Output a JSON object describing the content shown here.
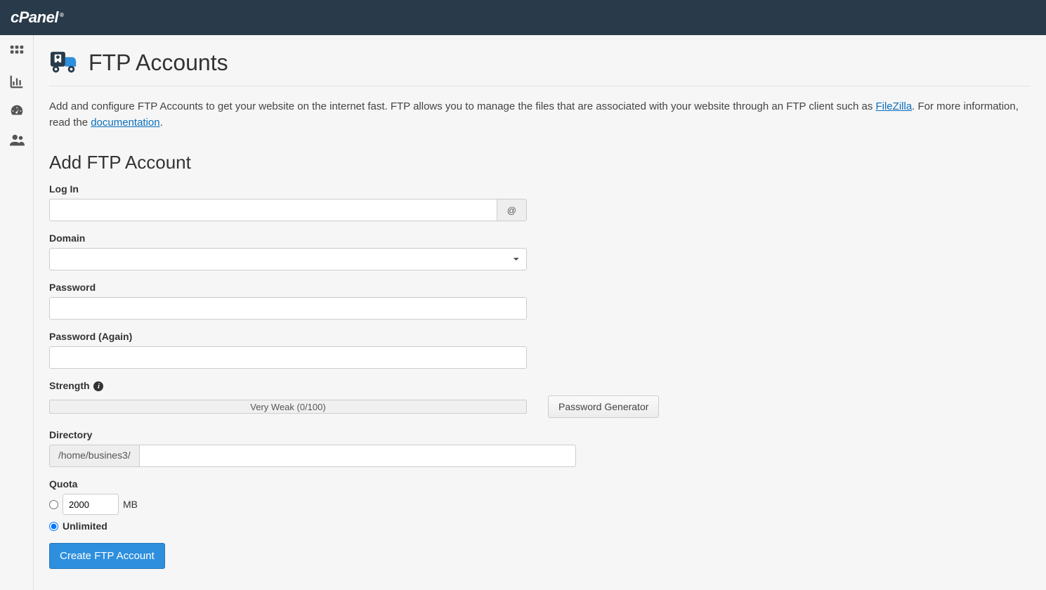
{
  "brand": "cPanel",
  "page": {
    "title": "FTP Accounts",
    "intro_pre": "Add and configure FTP Accounts to get your website on the internet fast. FTP allows you to manage the files that are associated with your website through an FTP client such as ",
    "intro_link1": "FileZilla",
    "intro_mid": ". For more information, read the ",
    "intro_link2": "documentation",
    "intro_post": "."
  },
  "section_title": "Add FTP Account",
  "labels": {
    "login": "Log In",
    "at": "@",
    "domain": "Domain",
    "password": "Password",
    "password_again": "Password (Again)",
    "strength": "Strength",
    "directory": "Directory",
    "quota": "Quota",
    "mb": "MB",
    "unlimited": "Unlimited"
  },
  "strength_text": "Very Weak (0/100)",
  "buttons": {
    "password_generator": "Password Generator",
    "create": "Create FTP Account"
  },
  "values": {
    "login": "",
    "domain": "",
    "password": "",
    "password_again": "",
    "dir_prefix": "/home/busines3/",
    "dir": "",
    "quota_value": "2000",
    "quota_selected": "unlimited"
  }
}
